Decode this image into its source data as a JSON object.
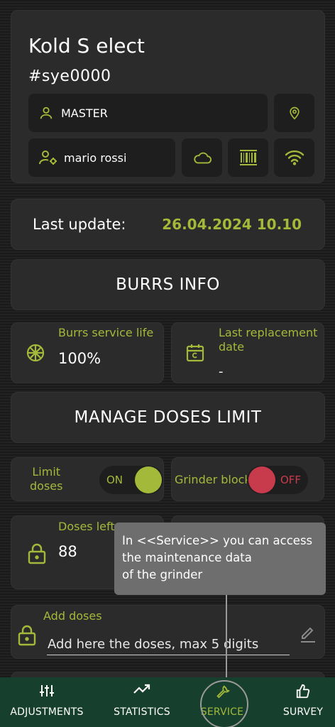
{
  "header": {
    "machine_name": "Kold S elect",
    "serial": "#sye0000",
    "role": "MASTER",
    "user": "mario rossi",
    "icons": [
      "user-icon",
      "location-pin-icon",
      "user-gear-icon",
      "cloud-icon",
      "barcode-icon",
      "wifi-icon"
    ]
  },
  "last_update": {
    "label": "Last update:",
    "value": "26.04.2024 10.10"
  },
  "burrs": {
    "title": "BURRS INFO",
    "service_life_label": "Burrs service life",
    "service_life_value": "100%",
    "replacement_label_line1": "Last replacement",
    "replacement_label_line2": "date",
    "replacement_value": "-"
  },
  "doses": {
    "title": "MANAGE DOSES LIMIT",
    "limit_label_line1": "Limit",
    "limit_label_line2": "doses",
    "limit_state": "ON",
    "block_label": "Grinder block",
    "block_state": "OFF",
    "doses_left_label": "Doses left",
    "doses_left_value": "88",
    "add_label": "Add doses",
    "add_placeholder": "Add here the doses, max 5 digits"
  },
  "tooltip": {
    "line1": "In <<Service>> you can access",
    "line2": "the maintenance data",
    "line3": "of the grinder"
  },
  "nav": {
    "adjustments": "ADJUSTMENTS",
    "statistics": "STATISTICS",
    "service": "SERVICE",
    "survey": "SURVEY",
    "active": "SERVICE"
  },
  "colors": {
    "accent": "#a3b93a",
    "danger": "#c73b4c",
    "nav_bg": "#173f2e",
    "card_bg": "#2b2b2b",
    "inner_bg": "#1e1e1e",
    "tooltip_bg": "#6e6e6e"
  }
}
